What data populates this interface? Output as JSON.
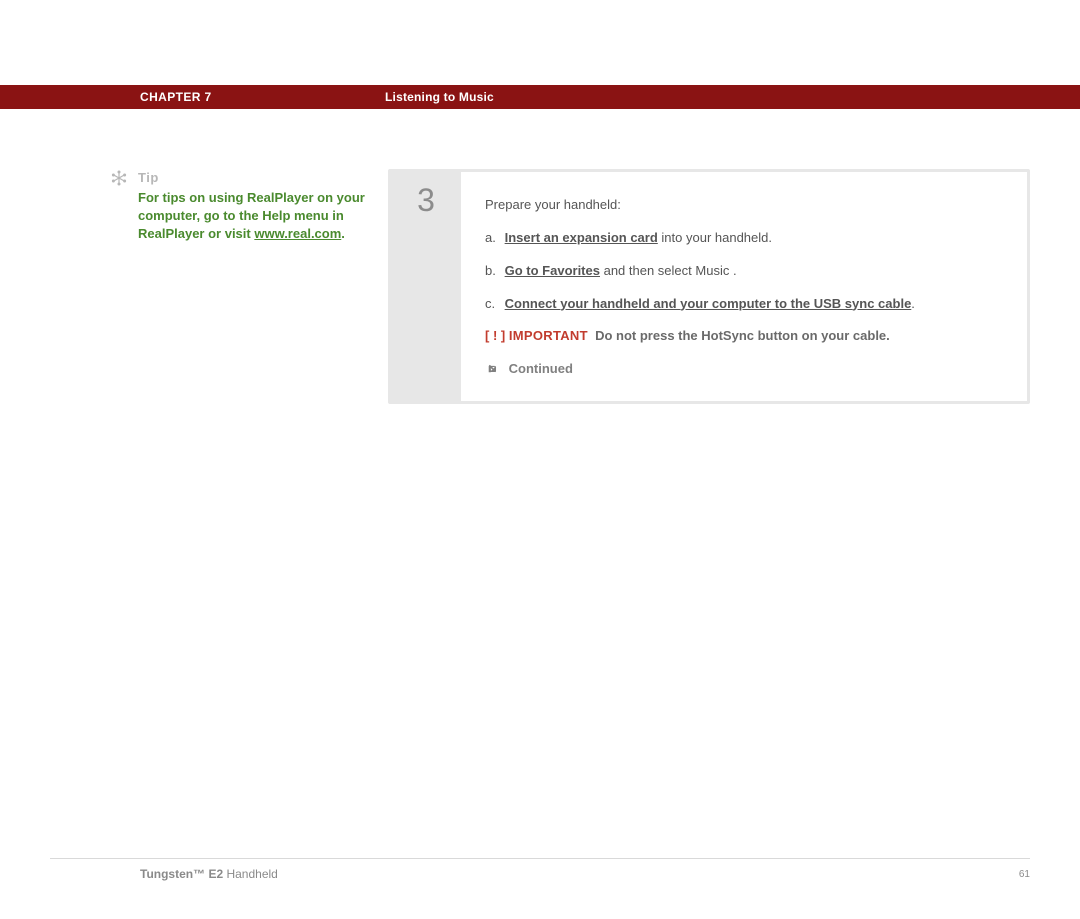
{
  "header": {
    "chapter": "CHAPTER 7",
    "title": "Listening to Music"
  },
  "tip": {
    "label": "Tip",
    "body_pre": "For tips on using RealPlayer on your computer, go to the Help menu in RealPlayer or visit ",
    "link": "www.real.com",
    "body_post": "."
  },
  "step": {
    "number": "3",
    "intro": "Prepare your handheld:",
    "items": [
      {
        "marker": "a.",
        "link": "Insert an expansion card",
        "rest": " into your handheld."
      },
      {
        "marker": "b.",
        "link": "Go to Favorites",
        "rest_pre": " and then select Music ",
        "rest_post": "."
      },
      {
        "marker": "c.",
        "link": "Connect your handheld and your computer to the USB sync cable",
        "rest": "."
      }
    ],
    "important": {
      "brackets": "[ ! ]",
      "label": "IMPORTANT",
      "text": "Do not press the HotSync button on your cable."
    },
    "continued": "Continued"
  },
  "footer": {
    "product_bold": "Tungsten™ E2",
    "product_rest": " Handheld",
    "page": "61"
  }
}
